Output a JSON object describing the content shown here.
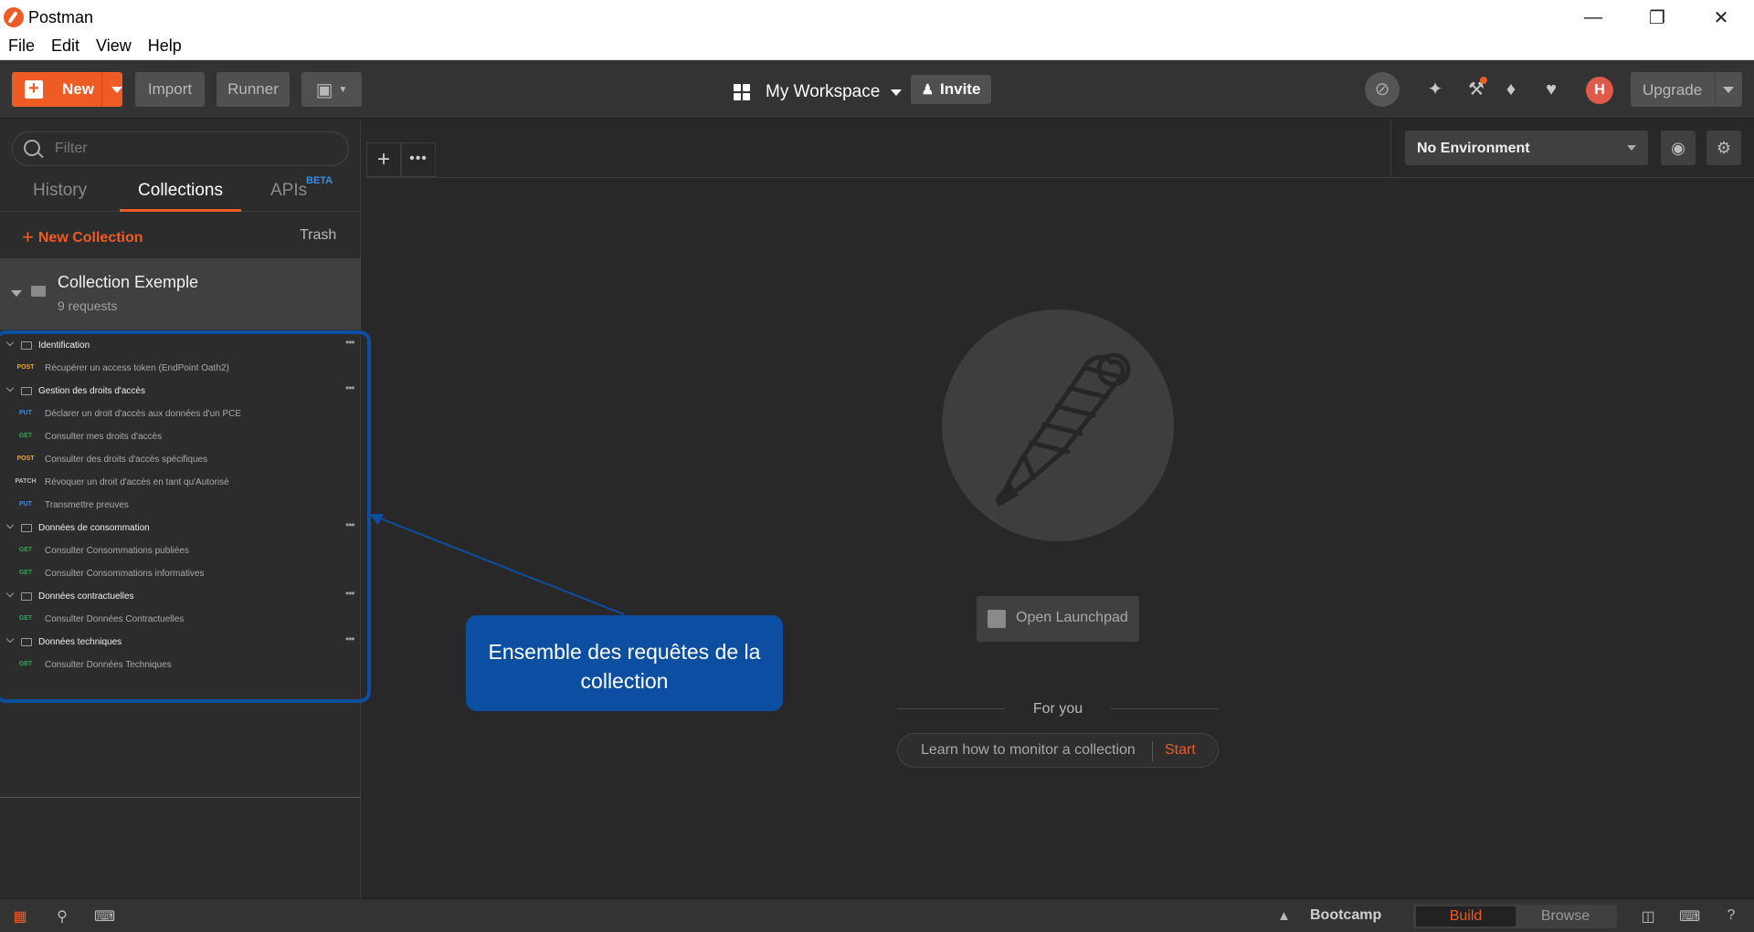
{
  "window": {
    "title": "Postman",
    "controls": [
      "minimize-icon",
      "restore-icon",
      "close-icon"
    ]
  },
  "menu": {
    "items": [
      "File",
      "Edit",
      "View",
      "Help"
    ]
  },
  "header": {
    "new_label": "New",
    "import_label": "Import",
    "runner_label": "Runner",
    "workspace_label": "My Workspace",
    "invite_label": "Invite",
    "upgrade_label": "Upgrade",
    "avatar_initial": "H",
    "accent_color": "#ef5b25"
  },
  "sidebar": {
    "filter_placeholder": "Filter",
    "tabs": [
      {
        "label": "History",
        "active": false
      },
      {
        "label": "Collections",
        "active": true
      },
      {
        "label": "APIs",
        "active": false,
        "badge": "BETA"
      }
    ],
    "new_collection_label": "New Collection",
    "trash_label": "Trash",
    "collection": {
      "name": "Collection Exemple",
      "count": "9 requests"
    },
    "tree": [
      {
        "type": "folder",
        "label": "Identification"
      },
      {
        "type": "request",
        "method": "POST",
        "label": "Récupérer un access token (EndPoint Oath2)"
      },
      {
        "type": "folder",
        "label": "Gestion des droits d'accès"
      },
      {
        "type": "request",
        "method": "PUT",
        "label": "Déclarer un droit d'accès aux données d'un PCE"
      },
      {
        "type": "request",
        "method": "GET",
        "label": "Consulter mes droits d'accès"
      },
      {
        "type": "request",
        "method": "POST",
        "label": "Consulter des droits d'accès spécifiques"
      },
      {
        "type": "request",
        "method": "PATCH",
        "label": "Révoquer un droit d'accès en tant qu'Autorisé"
      },
      {
        "type": "request",
        "method": "PUT",
        "label": "Transmettre preuves"
      },
      {
        "type": "folder",
        "label": "Données de consommation"
      },
      {
        "type": "request",
        "method": "GET",
        "label": "Consulter Consommations publiées"
      },
      {
        "type": "request",
        "method": "GET",
        "label": "Consulter Consommations informatives"
      },
      {
        "type": "folder",
        "label": "Données contractuelles"
      },
      {
        "type": "request",
        "method": "GET",
        "label": "Consulter Données Contractuelles"
      },
      {
        "type": "folder",
        "label": "Données techniques"
      },
      {
        "type": "request",
        "method": "GET",
        "label": "Consulter Données Techniques"
      }
    ],
    "method_colors": {
      "POST": "#f5a623",
      "GET": "#2fa84f",
      "PUT": "#3d8be8",
      "PATCH": "#bbbbbb"
    }
  },
  "environment": {
    "selected": "No Environment"
  },
  "launchpad": {
    "open_label": "Open Launchpad",
    "for_you_label": "For you",
    "tip_text": "Learn how to monitor a collection",
    "tip_action": "Start"
  },
  "annotation": {
    "text": "Ensemble des requêtes de la collection",
    "color": "#0b4ea2"
  },
  "statusbar": {
    "bootcamp_label": "Bootcamp",
    "build_label": "Build",
    "browse_label": "Browse",
    "active_mode": "Build"
  }
}
